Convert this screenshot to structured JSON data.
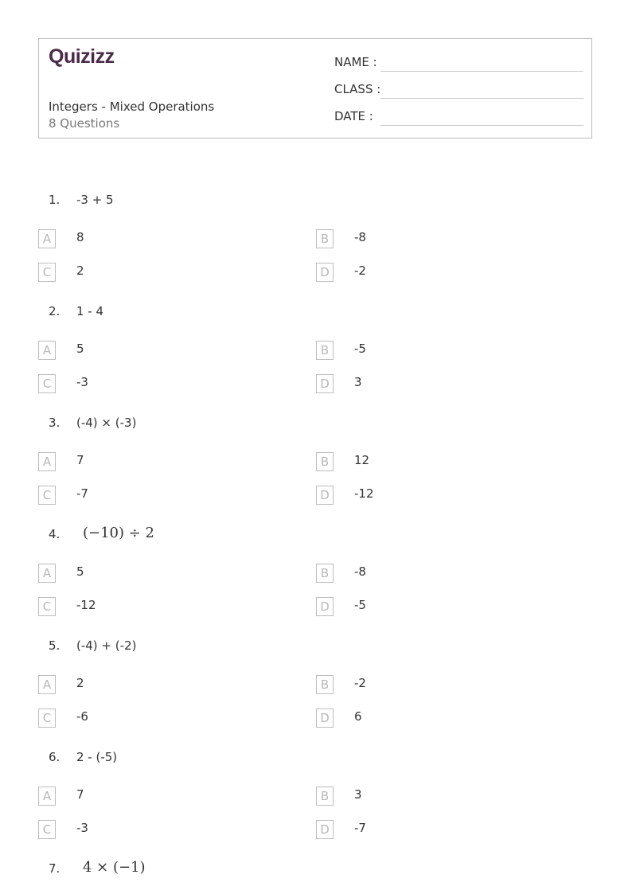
{
  "header": {
    "logo": "Quizizz",
    "title": "Integers - Mixed Operations",
    "subtitle": "8 Questions",
    "fields": [
      {
        "label": "NAME :"
      },
      {
        "label": "CLASS :"
      },
      {
        "label": "DATE  :"
      }
    ]
  },
  "questions": [
    {
      "number": "1.",
      "text": "-3 + 5",
      "math": false,
      "options": [
        {
          "letter": "A",
          "text": "8"
        },
        {
          "letter": "B",
          "text": "-8"
        },
        {
          "letter": "C",
          "text": "2"
        },
        {
          "letter": "D",
          "text": "-2"
        }
      ]
    },
    {
      "number": "2.",
      "text": "1 - 4",
      "math": false,
      "options": [
        {
          "letter": "A",
          "text": "5"
        },
        {
          "letter": "B",
          "text": "-5"
        },
        {
          "letter": "C",
          "text": "-3"
        },
        {
          "letter": "D",
          "text": "3"
        }
      ]
    },
    {
      "number": "3.",
      "text": "(-4)  ×  (-3)",
      "math": false,
      "options": [
        {
          "letter": "A",
          "text": "7"
        },
        {
          "letter": "B",
          "text": "12"
        },
        {
          "letter": "C",
          "text": "-7"
        },
        {
          "letter": "D",
          "text": "-12"
        }
      ]
    },
    {
      "number": "4.",
      "text": "(−10) ÷ 2",
      "math": true,
      "options": [
        {
          "letter": "A",
          "text": "5"
        },
        {
          "letter": "B",
          "text": "-8"
        },
        {
          "letter": "C",
          "text": "-12"
        },
        {
          "letter": "D",
          "text": "-5"
        }
      ]
    },
    {
      "number": "5.",
      "text": "(-4) + (-2)",
      "math": false,
      "options": [
        {
          "letter": "A",
          "text": "2"
        },
        {
          "letter": "B",
          "text": "-2"
        },
        {
          "letter": "C",
          "text": "-6"
        },
        {
          "letter": "D",
          "text": "6"
        }
      ]
    },
    {
      "number": "6.",
      "text": "2 - (-5)",
      "math": false,
      "options": [
        {
          "letter": "A",
          "text": "7"
        },
        {
          "letter": "B",
          "text": "3"
        },
        {
          "letter": "C",
          "text": "-3"
        },
        {
          "letter": "D",
          "text": "-7"
        }
      ]
    },
    {
      "number": "7.",
      "text": "4 × (−1)",
      "math": true,
      "options": []
    }
  ]
}
